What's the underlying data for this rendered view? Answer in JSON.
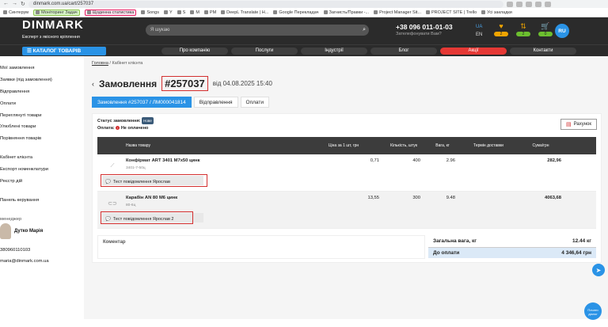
{
  "browser": {
    "url": "dinmark.com.ua/cart/257037"
  },
  "bookmarks": [
    {
      "label": "Синтерум",
      "style": "plain"
    },
    {
      "label": "Моніторинг Задач",
      "style": "g"
    },
    {
      "label": "Щоденна статистика",
      "style": "pk"
    },
    {
      "label": "Songs",
      "style": "plain"
    },
    {
      "label": "Y",
      "style": "plain"
    },
    {
      "label": "S",
      "style": "plain"
    },
    {
      "label": "M",
      "style": "plain"
    },
    {
      "label": "PM",
      "style": "plain"
    },
    {
      "label": "DeepL Translate | H...",
      "style": "plain"
    },
    {
      "label": "Google Перекладач",
      "style": "plain"
    },
    {
      "label": "Загнисть/Правки -...",
      "style": "plain"
    },
    {
      "label": "Project Manager Sit...",
      "style": "plain"
    },
    {
      "label": "PROJECT SITE | Trello",
      "style": "plain"
    },
    {
      "label": "Усі закладки",
      "style": "plain"
    }
  ],
  "header": {
    "logo": "DINMARK",
    "tagline": "Експерт з якісного кріплення",
    "search_placeholder": "Я шукаю",
    "phone": "+38 096 011-01-03",
    "callback": "Зателефонувати Вам?",
    "lang_active": "UA",
    "lang_other": "EN",
    "counters": [
      "2",
      "2",
      "0"
    ],
    "user_badge": "RU"
  },
  "menu": {
    "catalog": "КАТАЛОГ ТОВАРІВ",
    "items": [
      "Про компанію",
      "Послуги",
      "Індустрії",
      "Блог",
      "Акції",
      "Контакти"
    ]
  },
  "sidebar": {
    "items": [
      "Мої замовлення",
      "Заявки (під замовлення)",
      "Відправлення",
      "Оплати",
      "Переглянуті товари",
      "Улюблені товари",
      "Порівняння товарів"
    ],
    "items2": [
      "Кабінет клієнта",
      "Експорт номенклатури",
      "Реєстр дій"
    ],
    "panel": "Панель керування",
    "manager_label": "менеджер",
    "manager_name": "Дутко Марія",
    "manager_phone": "380960110103",
    "manager_email": "maria@dinmark.com.ua"
  },
  "page": {
    "breadcrumb_home": "Головна",
    "breadcrumb_current": "Кабінет клієнта",
    "title": "Замовлення",
    "order_number": "#257037",
    "date": "від 04.08.2025 15:40",
    "tabs": [
      "Замовлення #257037 / ЛМ000041814",
      "Відправлення",
      "Оплати"
    ],
    "status_label": "Статус замовлення:",
    "status_value": "Нове",
    "payment_label": "Оплата:",
    "payment_value": "Не оплачено",
    "invoice_button": "Рахунок"
  },
  "table": {
    "headers": [
      "Назва товару",
      "Ціна за 1 шт, грн",
      "Кількість, штук",
      "Вага, кг",
      "Термін доставки",
      "Сума/грн"
    ],
    "rows": [
      {
        "name": "Конфірмат ART 3401 M7x50 цинк",
        "sku": "3401-7-50ц",
        "price": "0,71",
        "qty": "400",
        "weight": "2.96",
        "delivery": "",
        "sum": "282,96",
        "message": "Тест повідомлення Ярослав"
      },
      {
        "name": "Карабін AN 80 M6 цинк",
        "sku": "80-6ц",
        "price": "13,55",
        "qty": "300",
        "weight": "9.48",
        "delivery": "",
        "sum": "4063,68",
        "message": "Тест повідомлення Ярослав 2"
      }
    ]
  },
  "summary": {
    "comment_label": "Коментар",
    "weight_label": "Загальна вага, кг",
    "weight_value": "12.44 кг",
    "total_label": "До оплати",
    "total_value": "4 346,64 грн"
  },
  "chat": {
    "label": "Почати діалог"
  }
}
